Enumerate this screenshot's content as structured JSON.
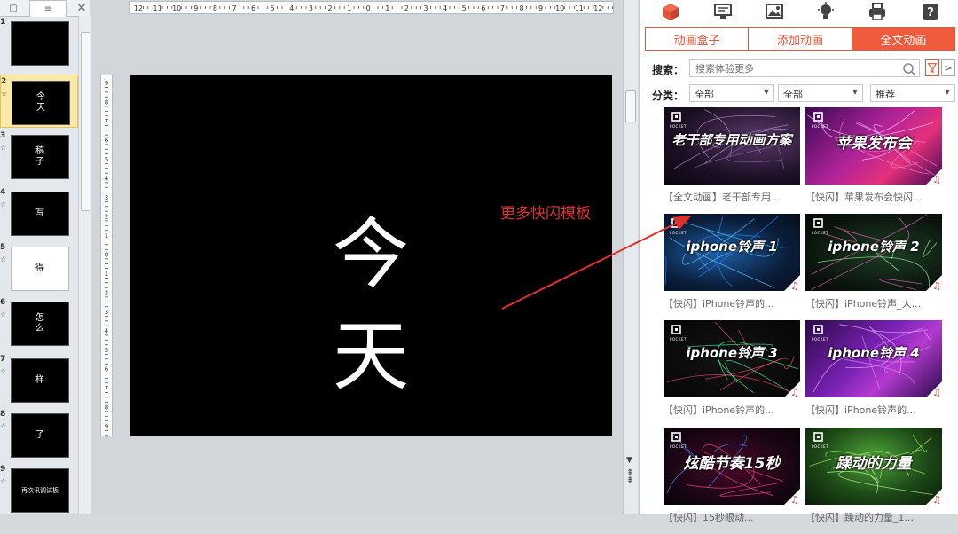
{
  "slide_panel": {
    "tabs": [
      "▢",
      "≡",
      "✕"
    ],
    "slides": [
      {
        "num": "1",
        "text": "",
        "style": "black"
      },
      {
        "num": "2",
        "text": "今\n天",
        "style": "black",
        "selected": true
      },
      {
        "num": "3",
        "text": "稿\n子",
        "style": "black"
      },
      {
        "num": "4",
        "text": "写",
        "style": "black"
      },
      {
        "num": "5",
        "text": "得",
        "style": "white"
      },
      {
        "num": "6",
        "text": "怎\n么",
        "style": "black"
      },
      {
        "num": "7",
        "text": "样",
        "style": "black"
      },
      {
        "num": "8",
        "text": "了",
        "style": "black"
      },
      {
        "num": "9",
        "text": "再次讯调试板",
        "style": "black"
      }
    ],
    "star": "☆"
  },
  "slide": {
    "line1": "今",
    "line2": "天"
  },
  "annotation": "更多快闪模板",
  "right_panel": {
    "icons": [
      "cube-icon",
      "monitor-icon",
      "image-icon",
      "bulb-icon",
      "printer-icon",
      "help-icon"
    ],
    "tabs": [
      {
        "label": "动画盒子",
        "active": false
      },
      {
        "label": "添加动画",
        "active": false
      },
      {
        "label": "全文动画",
        "active": true
      }
    ],
    "search_label": "搜索：",
    "search_placeholder": "搜索体验更多",
    "next_label": ">",
    "category_label": "分类：",
    "selects": [
      "全部",
      "全部",
      "推荐"
    ],
    "colors": {
      "accent": "#ef5b3c",
      "note": "#e2403a"
    },
    "cards": [
      {
        "title": "老干部专用动画方案",
        "caption": "【全文动画】老干部专用...",
        "theme": "dark-purple",
        "music": false
      },
      {
        "title": "苹果发布会",
        "caption": "【快闪】苹果发布会快闪...",
        "theme": "magenta",
        "music": true
      },
      {
        "title": "iphone铃声 1",
        "caption": "【快闪】iPhone铃声的...",
        "theme": "blue-net",
        "music": true
      },
      {
        "title": "iphone铃声 2",
        "caption": "【快闪】iPhone铃声_大...",
        "theme": "green-tri",
        "music": true
      },
      {
        "title": "iphone铃声 3",
        "caption": "【快闪】iPhone铃声的...",
        "theme": "black-confetti",
        "music": true
      },
      {
        "title": "iphone铃声 4",
        "caption": "【快闪】iPhone铃声的...",
        "theme": "purple",
        "music": true
      },
      {
        "title": "炫酷节奏15秒",
        "caption": "【快闪】15秒眼动...",
        "theme": "red-lines",
        "music": true
      },
      {
        "title": "躁动的力量",
        "caption": "【快闪】躁动的力量_1...",
        "theme": "green",
        "music": true
      }
    ],
    "card_logo_text": "POCKET"
  }
}
